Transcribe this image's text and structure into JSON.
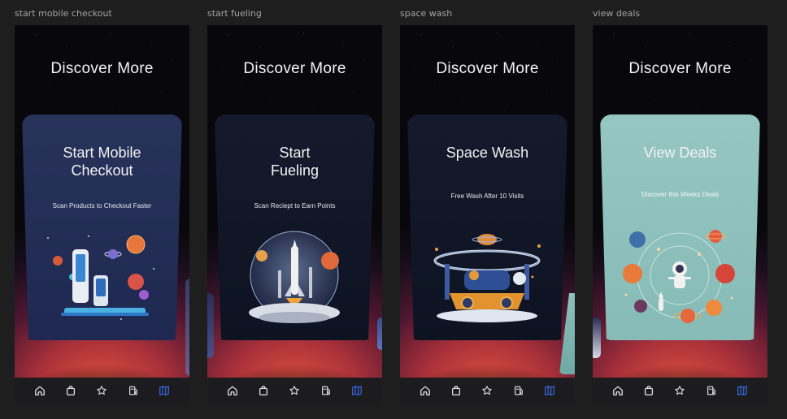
{
  "frames": [
    {
      "label": "start mobile checkout",
      "heading": "Discover More",
      "card_title_line1": "Start Mobile",
      "card_title_line2": "Checkout",
      "card_subtitle": "Scan Products to Checkout Faster",
      "card_theme": "navy",
      "art": "phones-and-planets-illustration"
    },
    {
      "label": "start fueling",
      "heading": "Discover More",
      "card_title_line1": "Start",
      "card_title_line2": "Fueling",
      "card_subtitle": "Scan Reciept to Earn Points",
      "card_theme": "dark",
      "art": "rocket-launch-globe-illustration"
    },
    {
      "label": "space wash",
      "heading": "Discover More",
      "card_title_line1": "Space Wash",
      "card_title_line2": "",
      "card_subtitle": "Free Wash After 10 Visits",
      "card_theme": "dark",
      "art": "space-car-wash-illustration"
    },
    {
      "label": "view deals",
      "heading": "Discover More",
      "card_title_line1": "View Deals",
      "card_title_line2": "",
      "card_subtitle": "Discover this Weeks Deals",
      "card_theme": "teal",
      "art": "astronaut-planets-illustration"
    }
  ],
  "tabbar": {
    "items": [
      {
        "icon": "home-icon"
      },
      {
        "icon": "shopping-bag-icon"
      },
      {
        "icon": "star-icon"
      },
      {
        "icon": "fuel-pump-icon"
      },
      {
        "icon": "map-icon",
        "active": true
      }
    ],
    "active_color": "#3b6cf6",
    "inactive_color": "#e8e8e8"
  },
  "colors": {
    "background": "#1e1e1e",
    "label": "#a3a3a3",
    "card_navy": "#28335a",
    "card_dark": "#141a2c",
    "card_teal": "#96c6c2"
  }
}
